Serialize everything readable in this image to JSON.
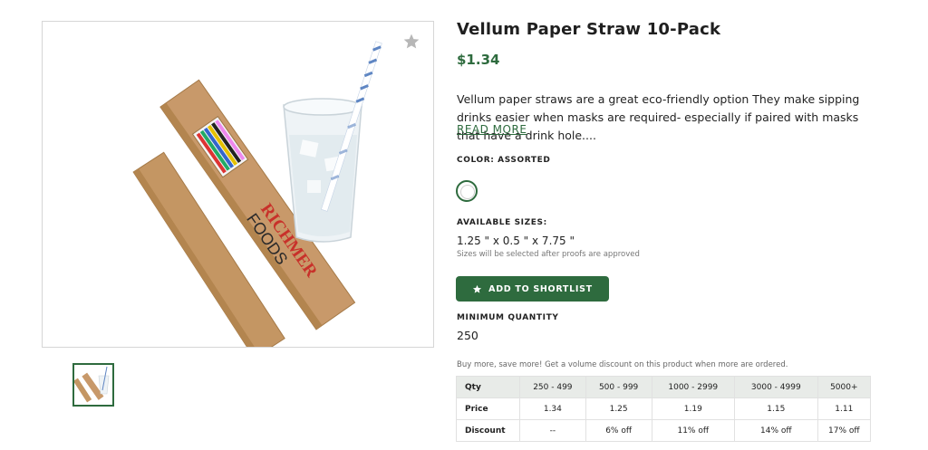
{
  "product": {
    "title": "Vellum Paper Straw 10-Pack",
    "price": "$1.34",
    "description": "Vellum paper straws are a great eco-friendly option They make sipping drinks easier when masks are required- especially if paired with masks that have a drink hole....",
    "read_more": "READ MORE",
    "image": {
      "box_brand_line1": "RICHMER",
      "box_brand_line2": "FOODS"
    }
  },
  "color": {
    "label": "COLOR: ASSORTED",
    "swatch": "#ffffff"
  },
  "sizes": {
    "label": "AVAILABLE SIZES:",
    "value": "1.25 \" x 0.5 \" x 7.75 \"",
    "note": "Sizes will be selected after proofs are approved"
  },
  "actions": {
    "shortlist_label": "ADD TO SHORTLIST"
  },
  "minimum": {
    "label": "MINIMUM QUANTITY",
    "value": "250"
  },
  "pricing": {
    "note": "Buy more, save more! Get a volume discount on this product when more are ordered.",
    "header": [
      "Qty",
      "250 - 499",
      "500 - 999",
      "1000 - 2999",
      "3000 - 4999",
      "5000+"
    ],
    "rows": [
      [
        "Price",
        "1.34",
        "1.25",
        "1.19",
        "1.15",
        "1.11"
      ],
      [
        "Discount",
        "--",
        "6% off",
        "11% off",
        "14% off",
        "17% off"
      ]
    ]
  },
  "colors": {
    "accent": "#2e6b3e",
    "header_bg": "#e8ebe8"
  },
  "icons": {
    "favorite": "star-icon",
    "button": "star-icon"
  }
}
